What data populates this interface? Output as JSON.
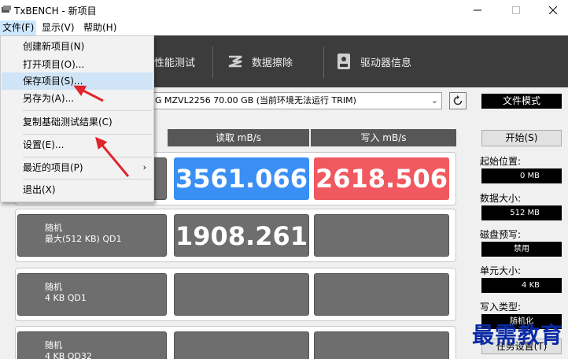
{
  "window": {
    "title": "TxBENCH - 新项目"
  },
  "menubar": {
    "items": [
      "文件(F)",
      "显示(V)",
      "帮助(H)"
    ]
  },
  "tabs": [
    {
      "label": "性能测试",
      "icon": "benchmark-icon"
    },
    {
      "label": "数据擦除",
      "icon": "erase-icon"
    },
    {
      "label": "驱动器信息",
      "icon": "drive-info-icon"
    }
  ],
  "drive": {
    "selected": "G MZVL2256  70.00 GB (当前环境无法运行 TRIM)"
  },
  "mode": "文件模式",
  "columns": {
    "read": "读取 mB/s",
    "write": "写入 mB/s"
  },
  "rows": [
    {
      "line1": "",
      "line2": "",
      "read": "3561.066",
      "write": "2618.506"
    },
    {
      "line1": "随机",
      "line2": "最大(512 KB) QD1",
      "read": "1908.261",
      "write": ""
    },
    {
      "line1": "随机",
      "line2": "4 KB QD1",
      "read": "",
      "write": ""
    },
    {
      "line1": "随机",
      "line2": "4 KB QD32",
      "read": "",
      "write": ""
    }
  ],
  "panel": {
    "start_label": "开始(S)",
    "params": [
      {
        "label": "起始位置:",
        "value": "0 MB"
      },
      {
        "label": "数据大小:",
        "value": "512 MB"
      },
      {
        "label": "磁盘预写:",
        "value": "禁用"
      },
      {
        "label": "单元大小:",
        "value": "4 KB"
      },
      {
        "label": "写入类型:",
        "value": "随机化"
      }
    ],
    "task_label": "任务设置(T)"
  },
  "file_menu": {
    "items": [
      {
        "label": "创建新项目(N)"
      },
      {
        "label": "打开项目(O)..."
      },
      {
        "label": "保存项目(S)..."
      },
      {
        "label": "另存为(A)..."
      },
      {
        "label": "复制基础测试结果(C)"
      },
      {
        "label": "设置(E)..."
      },
      {
        "label": "最近的项目(P)"
      },
      {
        "label": "退出(X)"
      }
    ]
  },
  "watermark": "最需教育",
  "colors": {
    "read": "#3a8ff5",
    "write": "#f0595f",
    "arrow": "#e0242b",
    "tabbar": "#3c3c3c"
  }
}
